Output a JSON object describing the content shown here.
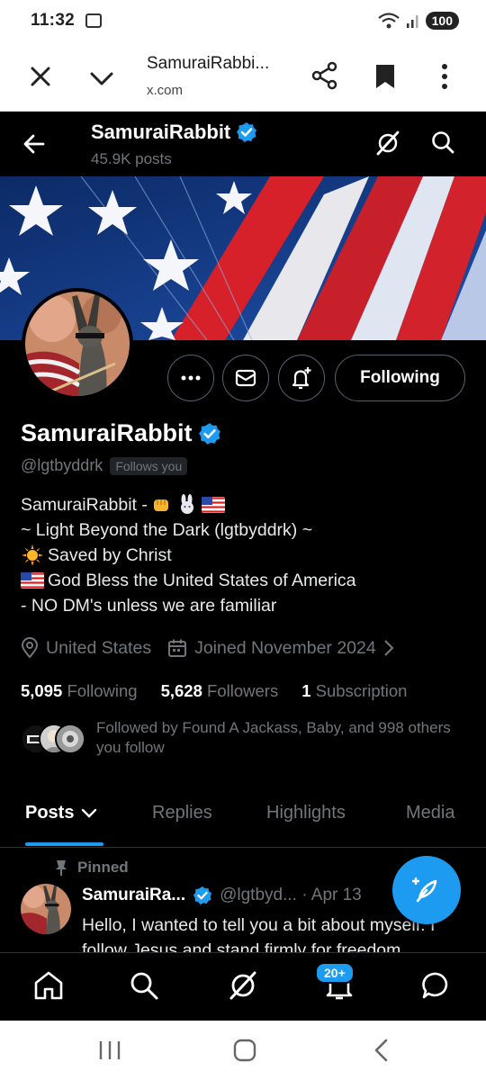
{
  "status_bar": {
    "time": "11:32",
    "battery": "100"
  },
  "browser": {
    "title": "SamuraiRabbi...",
    "url": "x.com"
  },
  "header": {
    "name": "SamuraiRabbit",
    "posts_count": "45.9K posts"
  },
  "profile": {
    "name": "SamuraiRabbit",
    "handle": "@lgtbyddrk",
    "follows_you": "Follows you",
    "bio": {
      "line1": "SamuraiRabbit - ",
      "line2": "~ Light Beyond the Dark (lgtbyddrk) ~",
      "line3": "Saved by Christ",
      "line4": "God Bless the United States of America",
      "line5": "- NO DM's unless we are familiar"
    },
    "location": "United States",
    "joined": "Joined November 2024",
    "following_count": "5,095",
    "following_label": "Following",
    "followers_count": "5,628",
    "followers_label": "Followers",
    "subscription_count": "1",
    "subscription_label": "Subscription",
    "followed_by": "Followed by Found A Jackass, Baby, and 998 others you follow",
    "follow_button": "Following"
  },
  "tabs": [
    "Posts",
    "Replies",
    "Highlights",
    "Media"
  ],
  "pinned_post": {
    "pinned_label": "Pinned",
    "author": "SamuraiRa...",
    "meta": "@lgtbyd... · Apr 13",
    "text": "Hello, I wanted to tell you a bit about myself. I follow Jesus and stand firmly for freedom"
  },
  "bottom_nav": {
    "notification_badge": "20+"
  },
  "colors": {
    "accent": "#1d9bf0",
    "background": "#000000",
    "muted": "#71767b"
  }
}
